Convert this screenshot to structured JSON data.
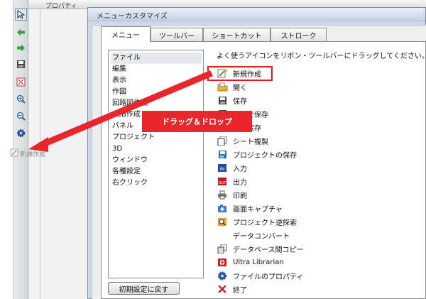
{
  "property_panel": {
    "title": "プロパティ"
  },
  "dialog": {
    "title": "メニューカスタマイズ",
    "tabs": [
      {
        "label": "メニュー",
        "active": true
      },
      {
        "label": "ツールバー"
      },
      {
        "label": "ショートカット"
      },
      {
        "label": "ストローク"
      }
    ],
    "hint": "よく使うアイコンをリボン・ツールバーにドラッグしてください。",
    "menu_items": [
      "ファイル",
      "編集",
      "表示",
      "作図",
      "回路図作成",
      "PCB作成",
      "パネル",
      "プロジェクト",
      "3D",
      "ウィンドウ",
      "各種設定",
      "右クリック"
    ],
    "reset_button": "初期設定に戻す",
    "commands": [
      {
        "label": "新規作成",
        "icon": "new-file-icon"
      },
      {
        "label": "開く",
        "icon": "open-folder-icon"
      },
      {
        "label": "保存",
        "icon": "save-icon"
      },
      {
        "label": "別名で保存",
        "icon": "save-as-icon"
      },
      {
        "label": "全て保存",
        "icon": "save-all-icon"
      },
      {
        "label": "シート複製",
        "icon": "sheet-copy-icon"
      },
      {
        "label": "プロジェクトの保存",
        "icon": "project-save-icon"
      },
      {
        "label": "入力",
        "icon": "input-icon"
      },
      {
        "label": "出力",
        "icon": "output-icon"
      },
      {
        "label": "印刷",
        "icon": "print-icon"
      },
      {
        "label": "画面キャプチャ",
        "icon": "camera-icon"
      },
      {
        "label": "プロジェクト逆探索",
        "icon": "reverse-search-icon"
      },
      {
        "label": "データコンバート",
        "icon": ""
      },
      {
        "label": "データベース間コピー",
        "icon": "db-copy-icon"
      },
      {
        "label": "Ultra Librarian",
        "icon": "ultra-librarian-icon"
      },
      {
        "label": "ファイルのプロパティ",
        "icon": "file-properties-icon"
      },
      {
        "label": "終了",
        "icon": "exit-icon"
      }
    ]
  },
  "annotation": {
    "drag_drop_label": "ドラッグ＆ドロップ"
  },
  "ghost_item": {
    "label": "新規作成"
  },
  "colors": {
    "highlight_red": "#d92020",
    "annotation_red": "#e8262b",
    "dialog_frame": "#cdd9e7"
  }
}
